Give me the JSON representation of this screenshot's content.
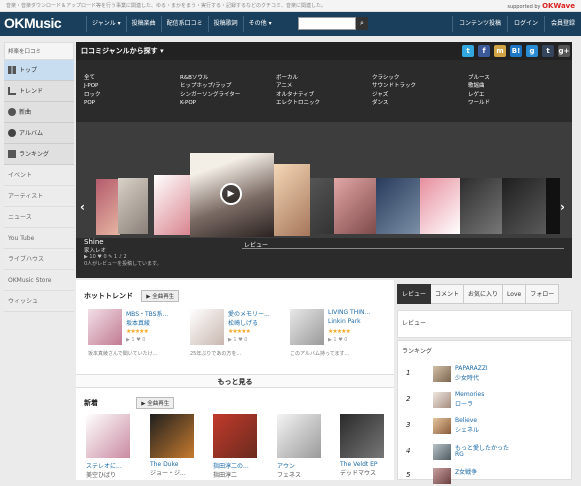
{
  "topbar": {
    "text": "音楽・音楽ダウンロード＆アップロード等を行う事業に関連した、ゆる・まかをまう・実行する・記録するなどのクチコミ、音楽に関連した。",
    "supported": "supported by",
    "brand": "OKWave"
  },
  "header": {
    "logo": "OKMusic",
    "nav": [
      "ジャンル ▾",
      "投稿楽曲",
      "配信系口コミ",
      "投稿歌詞",
      "その他 ▾"
    ],
    "right_nav": [
      "コンテンツ投稿",
      "ログイン",
      "会員登録"
    ],
    "search_placeholder": ""
  },
  "sidebar": {
    "head": "邦楽を口コミ",
    "items": [
      {
        "label": "トップ",
        "icon": "grid-icon",
        "active": true
      },
      {
        "label": "トレンド",
        "icon": "chart-icon",
        "active": false
      },
      {
        "label": "新曲",
        "icon": "disc-icon",
        "active": false
      },
      {
        "label": "アルバム",
        "icon": "album-icon",
        "active": false
      },
      {
        "label": "ランキング",
        "icon": "ranking-icon",
        "active": false
      }
    ],
    "plain": [
      "イベント",
      "アーティスト",
      "ニュース",
      "You Tube",
      "ライブハウス",
      "OKMusic Store",
      "ウィッシュ"
    ]
  },
  "genre_panel": {
    "title": "口コミジャンルから探す ▾",
    "columns": [
      [
        "全て",
        "J-POP",
        "ロック",
        "POP"
      ],
      [
        "R&Bソウル",
        "ヒップホップ/ラップ",
        "シンガーソングライター",
        "K-POP"
      ],
      [
        "ボーカル",
        "アニメ",
        "オルタナティブ",
        "エレクトロニック"
      ],
      [
        "クラシック",
        "サウンドトラック",
        "ジャズ",
        "ダンス"
      ],
      [
        "ブルース",
        "歌謡曲",
        "レゲエ",
        "ワールド"
      ]
    ]
  },
  "featured": {
    "title": "Shine",
    "artist": "家入レオ",
    "review_label": "レビュー",
    "stats": "▶ 10  ♥ 0  ✎ 1  ♪ 2",
    "meta": "0人がレビューを投稿しています。"
  },
  "hot_trend": {
    "title": "ホットトレンド",
    "play_all": "全曲再生",
    "more": "もっと見る",
    "items": [
      {
        "title": "MBS・TBS系...",
        "artist": "坂本真綾",
        "stars": "★★★★★",
        "meta": "▶ 1  ♥ 0",
        "comment": "坂本真綾さんで聞いていたけ..."
      },
      {
        "title": "愛のメモリー...",
        "artist": "松崎しげる",
        "stars": "★★★★★",
        "meta": "▶ 1  ♥ 0",
        "comment": "25年ぶりであの方を..."
      },
      {
        "title": "LIVING THIN...",
        "artist": "Linkin Park",
        "stars": "★★★★★",
        "meta": "▶ 1  ♥ 0",
        "comment": "このアルバム持ってます..."
      }
    ]
  },
  "new_releases": {
    "title": "新着",
    "play_all": "全曲再生",
    "items": [
      {
        "title": "ステレオに...",
        "artist": "美空ひばり"
      },
      {
        "title": "The Duke",
        "artist": "ジョー・ジ..."
      },
      {
        "title": "指田淳二の...",
        "artist": "指田淳二"
      },
      {
        "title": "アウン",
        "artist": "フェネス"
      },
      {
        "title": "The Veldt EP",
        "artist": "デッドマウス"
      }
    ]
  },
  "right_tabs": [
    "レビュー",
    "コメント",
    "お気に入り",
    "Love",
    "フォロー"
  ],
  "review_label": "レビュー",
  "ranking": {
    "title": "ランキング",
    "items": [
      {
        "num": "1",
        "title": "PAPARAZZI",
        "artist": "少女時代"
      },
      {
        "num": "2",
        "title": "Memories",
        "artist": "ローラ"
      },
      {
        "num": "3",
        "title": "Believe",
        "artist": "シェネル"
      },
      {
        "num": "4",
        "title": "もっと愛したかった",
        "artist": "RG"
      },
      {
        "num": "5",
        "title": "Z女戦争",
        "artist": ""
      }
    ]
  },
  "social_icons": [
    "twitter-icon",
    "facebook-icon",
    "mixi-icon",
    "hatena-icon",
    "google-icon",
    "tumblr-icon",
    "googleplus-icon"
  ]
}
